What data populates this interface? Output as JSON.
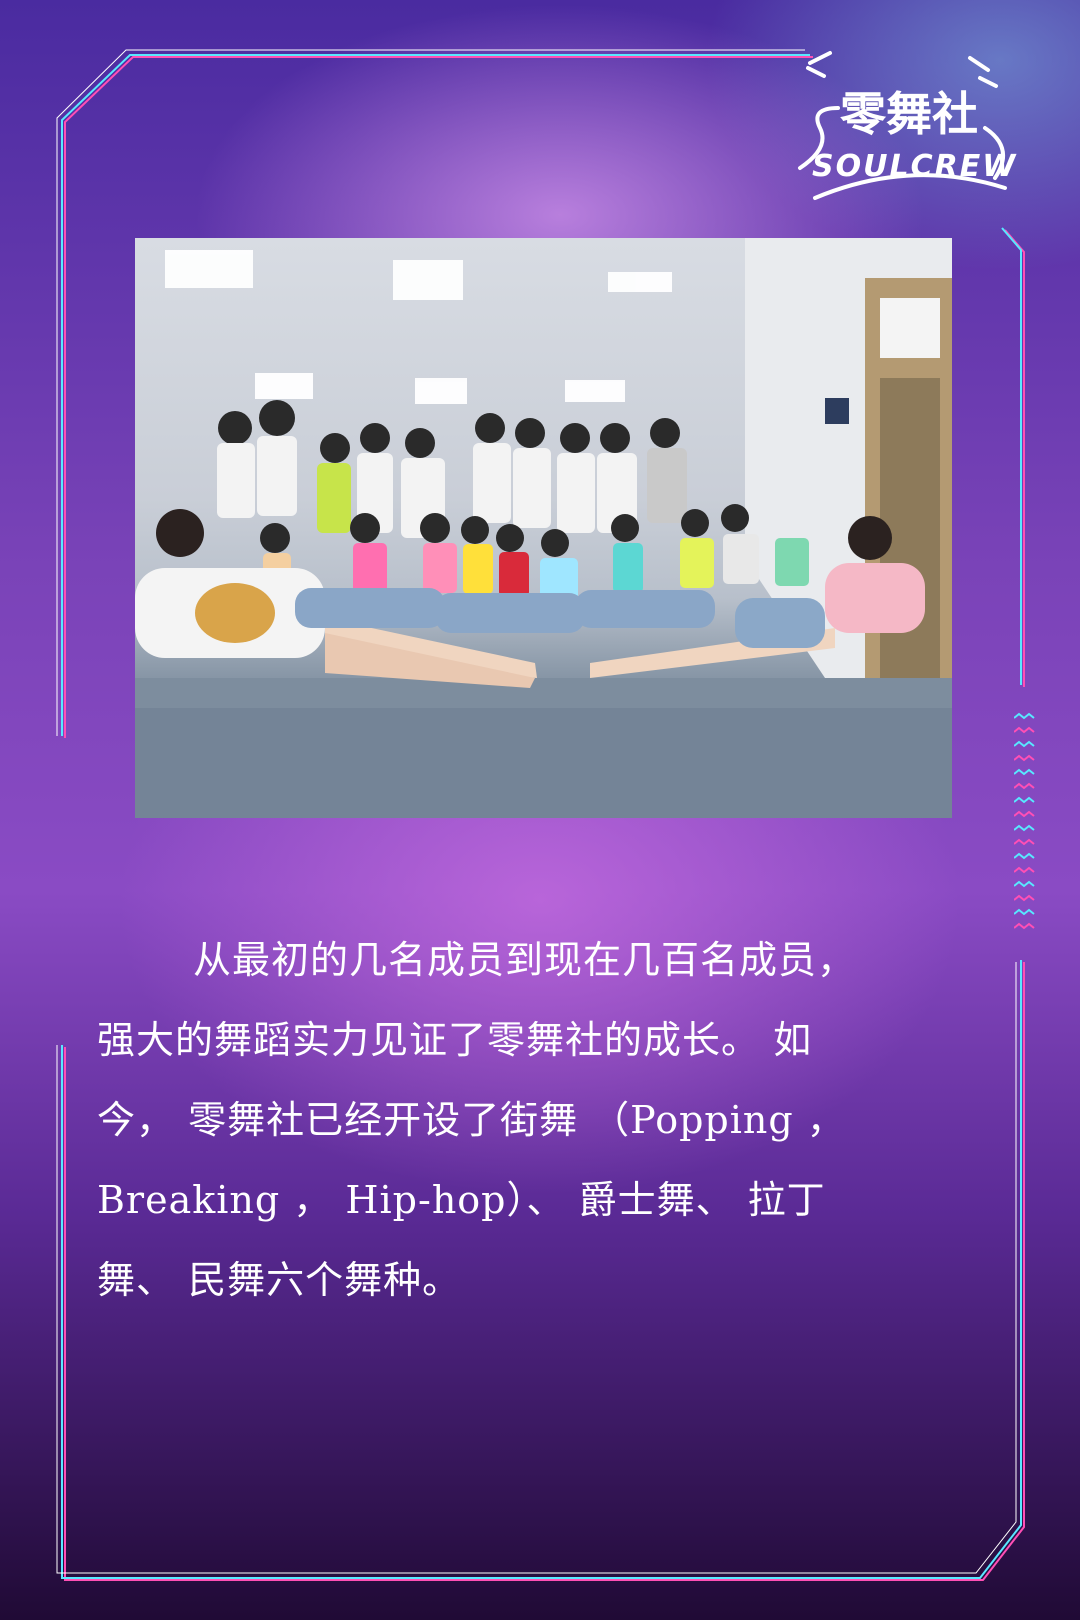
{
  "logo": {
    "text_cn": "零舞社",
    "text_en": "SOULCREW"
  },
  "photo": {
    "subject": "group-dance-photo"
  },
  "body": {
    "lines": [
      "从最初的几名成员到现在几百名成员，",
      "强大的舞蹈实力见证了零舞社的成长。 如",
      "今， 零舞社已经开设了街舞 （Popping ，",
      "Breaking ， Hip-hop）、 爵士舞、 拉丁",
      "舞、 民舞六个舞种。"
    ]
  },
  "colors": {
    "frame_cyan": "#58e8ff",
    "frame_pink": "#ff4fb5",
    "text": "#ffffff"
  }
}
